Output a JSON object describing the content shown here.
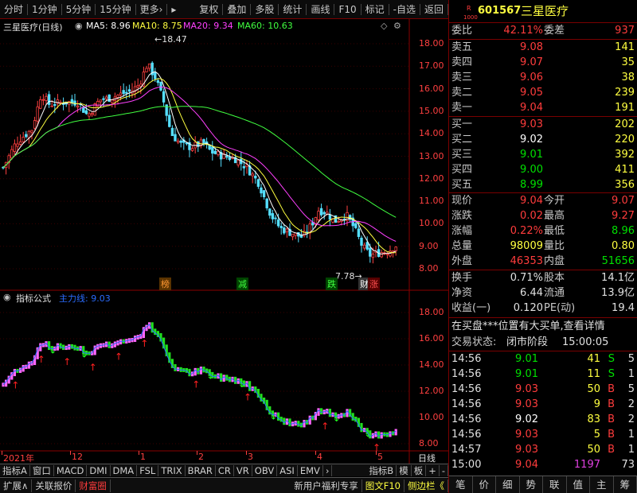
{
  "toolbar": {
    "items": [
      "分时",
      "1分钟",
      "5分钟",
      "15分钟",
      "更多›",
      "复权",
      "叠加",
      "多股",
      "统计",
      "画线",
      "F10",
      "标记",
      "-自选",
      "返回"
    ]
  },
  "main_chart": {
    "title": "三星医疗(日线)",
    "ma_labels": [
      {
        "text": "MA5: 8.96",
        "color": "#ffffff"
      },
      {
        "text": "MA10: 8.75",
        "color": "#ffff40"
      },
      {
        "text": "MA20: 9.34",
        "color": "#ff40ff"
      },
      {
        "text": "MA60: 10.63",
        "color": "#40ff40"
      }
    ],
    "high_label": "18.47",
    "low_label": "7.78",
    "y_ticks": [
      "18.00",
      "17.00",
      "16.00",
      "15.00",
      "14.00",
      "13.00",
      "12.00",
      "11.00",
      "10.00",
      "9.00",
      "8.00"
    ],
    "events": [
      {
        "text": "榜",
        "color": "#ff9933"
      },
      {
        "text": "减",
        "color": "#40ff40"
      },
      {
        "text": "跌",
        "color": "#40ff40"
      },
      {
        "text": "财",
        "color": "#ffffff"
      },
      {
        "text": "涨",
        "color": "#ff5050"
      }
    ]
  },
  "indicator": {
    "name": "指标公式",
    "line_label": "主力线: 9.03",
    "y_ticks": [
      "18.00",
      "16.00",
      "14.00",
      "12.00",
      "10.00",
      "8.00"
    ]
  },
  "date_axis": {
    "labels": [
      "2021年",
      "12",
      "1",
      "2",
      "3",
      "4",
      "5"
    ],
    "unit_label": "日线"
  },
  "bottom_tabs": [
    "指标A",
    "窗口",
    "MACD",
    "DMI",
    "DMA",
    "FSL",
    "TRIX",
    "BRAR",
    "CR",
    "VR",
    "OBV",
    "ASI",
    "EMV",
    "›",
    "指标B",
    "模",
    "板",
    "+",
    "-"
  ],
  "status_tabs": [
    "扩展∧",
    "关联报价",
    "财富圈",
    "新用户福利专享",
    "图文F10",
    "侧边栏《"
  ],
  "quote": {
    "code": "601567",
    "name": "三星医疗",
    "badge_top": "R",
    "badge_bottom": "1000",
    "weibi_label": "委比",
    "weibi_value": "42.11%",
    "weicha_label": "委差",
    "weicha_value": "937",
    "asks": [
      {
        "label": "卖五",
        "price": "9.08",
        "vol": "141",
        "color": "#ff3c3c"
      },
      {
        "label": "卖四",
        "price": "9.07",
        "vol": "35",
        "color": "#ff3c3c"
      },
      {
        "label": "卖三",
        "price": "9.06",
        "vol": "38",
        "color": "#ff3c3c"
      },
      {
        "label": "卖二",
        "price": "9.05",
        "vol": "239",
        "color": "#ff3c3c"
      },
      {
        "label": "卖一",
        "price": "9.04",
        "vol": "191",
        "color": "#ff3c3c"
      }
    ],
    "bids": [
      {
        "label": "买一",
        "price": "9.03",
        "vol": "202",
        "color": "#ff3c3c"
      },
      {
        "label": "买二",
        "price": "9.02",
        "vol": "220",
        "color": "#ffffff"
      },
      {
        "label": "买三",
        "price": "9.01",
        "vol": "392",
        "color": "#00e000"
      },
      {
        "label": "买四",
        "price": "9.00",
        "vol": "411",
        "color": "#00e000"
      },
      {
        "label": "买五",
        "price": "8.99",
        "vol": "356",
        "color": "#00e000"
      }
    ],
    "stats": [
      {
        "l1": "现价",
        "v1": "9.04",
        "c1": "#ff3c3c",
        "l2": "今开",
        "v2": "9.07",
        "c2": "#ff3c3c"
      },
      {
        "l1": "涨跌",
        "v1": "0.02",
        "c1": "#ff3c3c",
        "l2": "最高",
        "v2": "9.27",
        "c2": "#ff3c3c"
      },
      {
        "l1": "涨幅",
        "v1": "0.22%",
        "c1": "#ff3c3c",
        "l2": "最低",
        "v2": "8.96",
        "c2": "#00e000"
      },
      {
        "l1": "总量",
        "v1": "98009",
        "c1": "#ffff40",
        "l2": "量比",
        "v2": "0.80",
        "c2": "#ffff40"
      },
      {
        "l1": "外盘",
        "v1": "46353",
        "c1": "#ff3c3c",
        "l2": "内盘",
        "v2": "51656",
        "c2": "#00e000"
      }
    ],
    "stats2": [
      {
        "l1": "换手",
        "v1": "0.71%",
        "l2": "股本",
        "v2": "14.1亿"
      },
      {
        "l1": "净资",
        "v1": "6.44",
        "l2": "流通",
        "v2": "13.9亿"
      },
      {
        "l1": "收益(一)",
        "v1": "0.120",
        "l2": "PE(动)",
        "v2": "19.4"
      }
    ],
    "notice": "在买盘***位置有大买单,查看详情",
    "trade_status_label": "交易状态:",
    "trade_status_value": "闭市阶段",
    "trade_time": "15:00:05",
    "ticks": [
      {
        "time": "14:56",
        "price": "9.01",
        "pc": "#00e000",
        "vol": "41",
        "vc": "#ffff40",
        "side": "S",
        "sc": "#00e000",
        "n": "5"
      },
      {
        "time": "14:56",
        "price": "9.01",
        "pc": "#00e000",
        "vol": "11",
        "vc": "#ffff40",
        "side": "S",
        "sc": "#00e000",
        "n": "1"
      },
      {
        "time": "14:56",
        "price": "9.03",
        "pc": "#ff3c3c",
        "vol": "50",
        "vc": "#ffff40",
        "side": "B",
        "sc": "#ff3c3c",
        "n": "5"
      },
      {
        "time": "14:56",
        "price": "9.03",
        "pc": "#ff3c3c",
        "vol": "9",
        "vc": "#ffff40",
        "side": "B",
        "sc": "#ff3c3c",
        "n": "2"
      },
      {
        "time": "14:56",
        "price": "9.02",
        "pc": "#ffffff",
        "vol": "83",
        "vc": "#ffff40",
        "side": "B",
        "sc": "#ff3c3c",
        "n": "2"
      },
      {
        "time": "14:56",
        "price": "9.03",
        "pc": "#ff3c3c",
        "vol": "5",
        "vc": "#ffff40",
        "side": "B",
        "sc": "#ff3c3c",
        "n": "1"
      },
      {
        "time": "14:57",
        "price": "9.03",
        "pc": "#ff3c3c",
        "vol": "50",
        "vc": "#ffff40",
        "side": "B",
        "sc": "#ff3c3c",
        "n": "1"
      },
      {
        "time": "15:00",
        "price": "9.04",
        "pc": "#ff3c3c",
        "vol": "1197",
        "vc": "#e040e0",
        "side": "",
        "sc": "#ffffff",
        "n": "73"
      }
    ],
    "tabs": [
      "笔",
      "价",
      "细",
      "势",
      "联",
      "值",
      "主",
      "筹"
    ]
  }
}
